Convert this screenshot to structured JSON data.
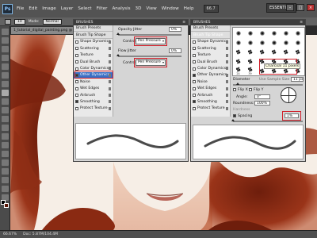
{
  "menubar": {
    "logo": "Ps",
    "items": [
      "File",
      "Edit",
      "Image",
      "Layer",
      "Select",
      "Filter",
      "Analysis",
      "3D",
      "View",
      "Window",
      "Help"
    ],
    "zoom": "66.7",
    "workspace": "ESSENTIALS",
    "window_buttons": [
      "–",
      "□",
      "×"
    ]
  },
  "options": {
    "brush_size": "10",
    "mode_label": "Mode:",
    "mode_value": "Normal"
  },
  "document": {
    "tab_title": "1_tutorial_digital_painting.png @ 66"
  },
  "status": {
    "zoom": "66.67%",
    "doc": "Doc: 5.87M/104.4M"
  },
  "left_panel": {
    "header": "BRUSHES",
    "categories": [
      {
        "label": "Brush Presets",
        "title": true
      },
      {
        "label": "Brush Tip Shape",
        "title": true
      },
      {
        "label": "Shape Dynamics",
        "checked": false
      },
      {
        "label": "Scattering",
        "checked": false
      },
      {
        "label": "Texture",
        "checked": false
      },
      {
        "label": "Dual Brush",
        "checked": false
      },
      {
        "label": "Color Dynamics",
        "checked": false
      },
      {
        "label": "Other Dynamics",
        "checked": true,
        "selected": true
      },
      {
        "label": "Noise",
        "checked": false
      },
      {
        "label": "Wet Edges",
        "checked": false
      },
      {
        "label": "Airbrush",
        "checked": false
      },
      {
        "label": "Smoothing",
        "checked": true
      },
      {
        "label": "Protect Texture",
        "checked": false
      }
    ],
    "opacity_jitter_label": "Opacity Jitter",
    "opacity_jitter_value": "0%",
    "control1_label": "Control:",
    "control1_value": "Pen Pressure",
    "flow_jitter_label": "Flow Jitter",
    "flow_jitter_value": "0%",
    "control2_label": "Control:",
    "control2_value": "Pen Pressure"
  },
  "right_panel": {
    "header": "BRUSHES",
    "categories": [
      {
        "label": "Brush Presets",
        "title": true
      },
      {
        "label": "Brush Tip Shape",
        "selected": true,
        "title": true
      },
      {
        "label": "Shape Dynamics",
        "checked": false
      },
      {
        "label": "Scattering",
        "checked": false
      },
      {
        "label": "Texture",
        "checked": false
      },
      {
        "label": "Dual Brush",
        "checked": false
      },
      {
        "label": "Color Dynamics",
        "checked": false
      },
      {
        "label": "Other Dynamics",
        "checked": true
      },
      {
        "label": "Noise",
        "checked": false
      },
      {
        "label": "Wet Edges",
        "checked": false
      },
      {
        "label": "Airbrush",
        "checked": false
      },
      {
        "label": "Smoothing",
        "checked": true
      },
      {
        "label": "Protect Texture",
        "checked": false
      }
    ],
    "tips": [
      {
        "label": "",
        "kind": "dot"
      },
      {
        "label": "",
        "kind": "dot"
      },
      {
        "label": "",
        "kind": "dot"
      },
      {
        "label": "",
        "kind": "dot"
      },
      {
        "label": "",
        "kind": "dot"
      },
      {
        "label": "",
        "kind": "dot"
      },
      {
        "label": "",
        "kind": "dot"
      },
      {
        "label": "",
        "kind": "dot"
      },
      {
        "label": "",
        "kind": "dot"
      },
      {
        "label": "",
        "kind": "dot"
      },
      {
        "label": "",
        "kind": "dot"
      },
      {
        "label": "",
        "kind": "dot"
      },
      {
        "label": "",
        "kind": "splat"
      },
      {
        "label": "",
        "kind": "splat"
      },
      {
        "label": "",
        "kind": "splat"
      },
      {
        "label": "",
        "kind": "splat"
      },
      {
        "label": "",
        "kind": "splat"
      },
      {
        "label": "",
        "kind": "splat"
      },
      {
        "label": "",
        "kind": "splat"
      },
      {
        "label": "",
        "kind": "splat"
      },
      {
        "label": "",
        "kind": "splat"
      },
      {
        "label": "",
        "kind": "splat"
      },
      {
        "label": "",
        "kind": "splat"
      },
      {
        "label": "",
        "kind": "splat"
      },
      {
        "label": "24",
        "kind": "splat"
      },
      {
        "label": "39",
        "kind": "splat"
      },
      {
        "label": "",
        "kind": "splat"
      },
      {
        "label": "",
        "kind": "splat"
      },
      {
        "label": "",
        "kind": "splat"
      },
      {
        "label": "",
        "kind": "splat"
      }
    ],
    "tip_tooltip": "Charcoal 11 pixels",
    "diameter_label": "Diameter",
    "use_sample_size": "Use Sample Size",
    "diameter_value": "11 px",
    "flip_x": "Flip X",
    "flip_y": "Flip Y",
    "angle_label": "Angle:",
    "angle_value": "0°",
    "roundness_label": "Roundness:",
    "roundness_value": "100%",
    "hardness_label": "Hardness",
    "spacing_label": "Spacing",
    "spacing_value": "1%"
  },
  "colors": {
    "accent": "#d0202a",
    "selection": "#3a6fc4",
    "hair": "#8a2a12"
  }
}
